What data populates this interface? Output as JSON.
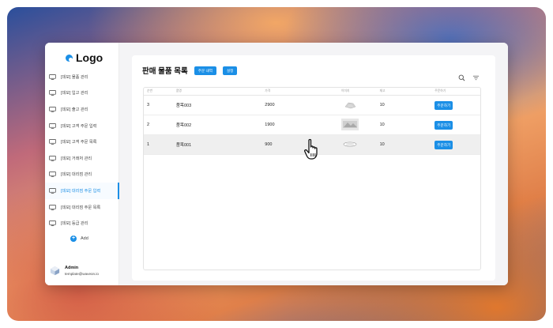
{
  "app": {
    "logo_text": "Logo"
  },
  "sidebar": {
    "items": [
      {
        "label": "[데모] 물품 관리",
        "active": false
      },
      {
        "label": "[데모] 입고 관리",
        "active": false
      },
      {
        "label": "[데모] 출고 관리",
        "active": false
      },
      {
        "label": "[데모] 고객 주문 입력",
        "active": false
      },
      {
        "label": "[데모] 고객 주문 목록",
        "active": false
      },
      {
        "label": "[데모] 거래처 관리",
        "active": false
      },
      {
        "label": "[데모] 대리점 관리",
        "active": false
      },
      {
        "label": "[데모] 대리점 주문 입력",
        "active": true
      },
      {
        "label": "[데모] 대리점 주문 목록",
        "active": false
      },
      {
        "label": "[데모] 등급 관리",
        "active": false
      }
    ],
    "add_label": "Add",
    "user": {
      "name": "Admin",
      "email": "template@waveon.io"
    }
  },
  "main": {
    "title": "판매 물품 목록",
    "buttons": {
      "order_history": "주문 내역",
      "settings": "설정"
    },
    "table": {
      "headers": [
        "순번",
        "품명",
        "가격",
        "이미지",
        "재고",
        "주문하기"
      ],
      "rows": [
        {
          "no": "3",
          "name": "품목003",
          "price": "2900",
          "stock": "10",
          "action": "주문하기",
          "image": "image-item-003"
        },
        {
          "no": "2",
          "name": "품목002",
          "price": "1900",
          "stock": "10",
          "action": "주문하기",
          "image": "image-item-002"
        },
        {
          "no": "1",
          "name": "품목001",
          "price": "900",
          "stock": "10",
          "action": "주문하기",
          "image": "image-item-001"
        }
      ]
    }
  },
  "icons": {
    "search": "search-icon",
    "filter": "filter-icon",
    "cursor": "hand-pointer-icon"
  },
  "colors": {
    "accent": "#1b8fe6",
    "hover_row": "#efefef"
  }
}
